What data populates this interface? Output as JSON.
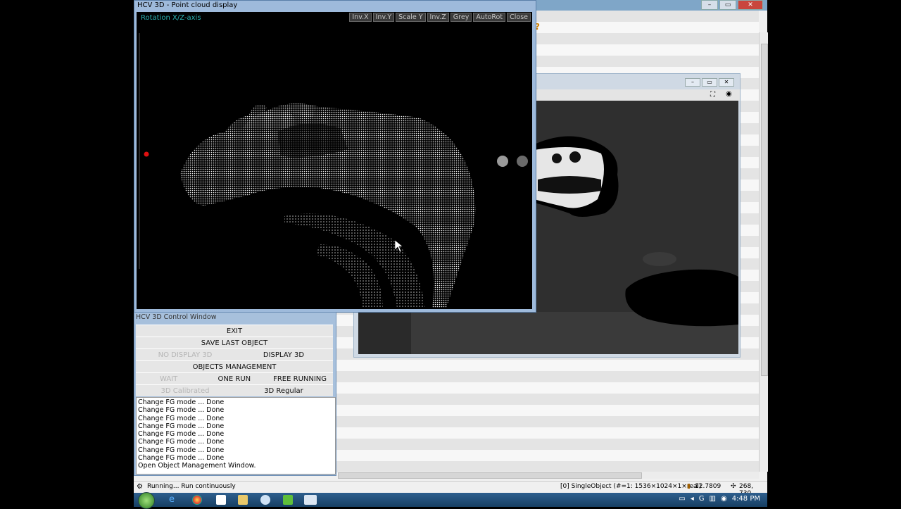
{
  "pointcloud_window": {
    "title": "HCV 3D - Point cloud display",
    "mode_label": "Rotation X/Z-axis",
    "buttons": [
      "Inv.X",
      "Inv.Y",
      "Scale Y",
      "Inv.Z",
      "Grey",
      "AutoRot",
      "Close"
    ]
  },
  "control_window": {
    "title": "HCV 3D Control Window",
    "exit": "EXIT",
    "save_last_object": "SAVE LAST OBJECT",
    "no_display_3d": "NO DISPLAY 3D",
    "display_3d": "DISPLAY 3D",
    "objects_management": "OBJECTS MANAGEMENT",
    "wait": "WAIT",
    "one_run": "ONE RUN",
    "free_running": "FREE RUNNING",
    "calibrated_3d": "3D Calibrated",
    "regular_3d": "3D Regular",
    "log": [
      "Change FG mode ... Done",
      "Change FG mode ... Done",
      "Change FG mode ... Done",
      "Change FG mode ... Done",
      "Change FG mode ... Done",
      "Change FG mode ... Done",
      "Change FG mode ... Done",
      "Change FG mode ... Done",
      "Open Object Management Window."
    ]
  },
  "statusbar": {
    "left": "Running... Run continuously",
    "object_info": "[0] SingleObject (#=1: 1536×1024×1×real)",
    "value": "12.7809",
    "coords": "268, 730"
  },
  "taskbar": {
    "time": "4:48 PM"
  },
  "colors": {
    "pc_label": "#2cb5b5",
    "window_border": "#9ebadb",
    "taskbar": "#1f4a74"
  }
}
